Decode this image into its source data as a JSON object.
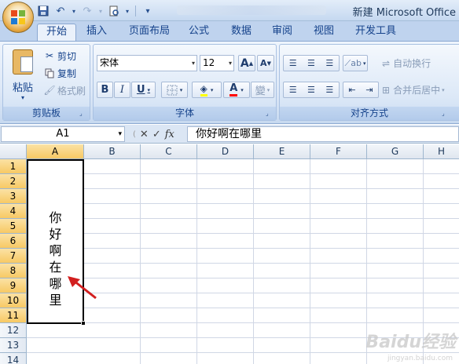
{
  "window": {
    "title": "新建 Microsoft Office"
  },
  "qat": {
    "save_icon": "save-icon",
    "undo_icon": "undo-icon",
    "redo_icon": "redo-icon",
    "print_preview_icon": "print-preview-icon",
    "customize_icon": "customize-icon"
  },
  "tabs": [
    {
      "label": "开始",
      "active": true
    },
    {
      "label": "插入"
    },
    {
      "label": "页面布局"
    },
    {
      "label": "公式"
    },
    {
      "label": "数据"
    },
    {
      "label": "审阅"
    },
    {
      "label": "视图"
    },
    {
      "label": "开发工具"
    }
  ],
  "clipboard": {
    "group_label": "剪贴板",
    "paste_label": "粘贴",
    "cut_label": "剪切",
    "copy_label": "复制",
    "format_painter_label": "格式刷"
  },
  "font": {
    "group_label": "字体",
    "family": "宋体",
    "size": "12",
    "grow_label": "A",
    "shrink_label": "A",
    "bold_label": "B",
    "italic_label": "I",
    "underline_label": "U",
    "phonetic_label": "變"
  },
  "alignment": {
    "group_label": "对齐方式",
    "wrap_label": "自动换行",
    "merge_label": "合并后居中"
  },
  "formula_bar": {
    "name_box": "A1",
    "fx_label": "fx",
    "content": "你好啊在哪里"
  },
  "grid": {
    "columns": [
      "A",
      "B",
      "C",
      "D",
      "E",
      "F",
      "G",
      "H"
    ],
    "rows": [
      "1",
      "2",
      "3",
      "4",
      "5",
      "6",
      "7",
      "8",
      "9",
      "10",
      "11",
      "12",
      "13",
      "14"
    ],
    "selected_cell": "A1",
    "cell_a1_chars": [
      "你",
      "好",
      "啊",
      "在",
      "哪",
      "里"
    ]
  },
  "watermark": {
    "text": "Baidu经验",
    "sub": "jingyan.baidu.com"
  },
  "colors": {
    "accent_red": "#d21f1f",
    "selection_header": "#f7c964"
  }
}
